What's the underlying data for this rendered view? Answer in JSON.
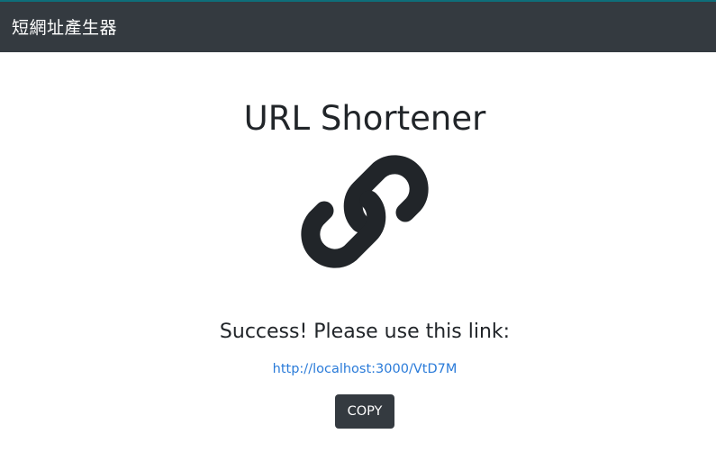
{
  "navbar": {
    "brand": "短網址產生器"
  },
  "main": {
    "title": "URL Shortener",
    "icon": "link-icon",
    "success_message": "Success! Please use this link:",
    "short_url": "http://localhost:3000/VtD7M",
    "copy_label": "COPY"
  },
  "colors": {
    "navbar_bg": "#343a40",
    "link": "#2a7bd9",
    "button_bg": "#343a40",
    "text": "#212529"
  }
}
